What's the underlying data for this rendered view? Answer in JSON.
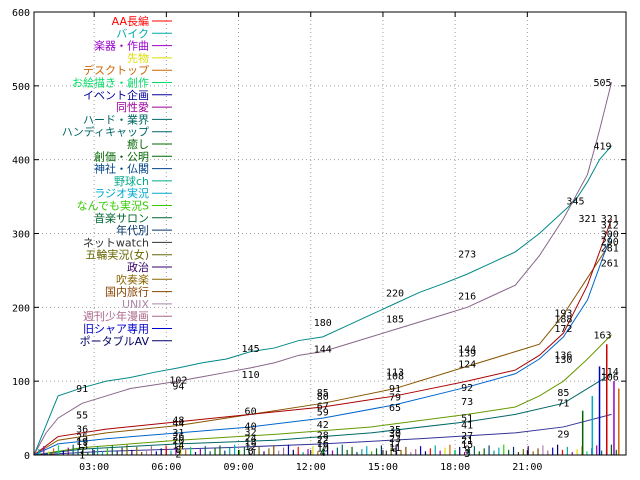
{
  "chart_data": {
    "type": "line",
    "x_ticks": [
      "03:00",
      "06:00",
      "09:00",
      "12:00",
      "15:00",
      "18:00",
      "21:00"
    ],
    "y_ticks": [
      "0",
      "100",
      "200",
      "300",
      "400",
      "500",
      "600"
    ],
    "ylim": [
      0,
      600
    ],
    "grid": true,
    "legend_position": "top-left",
    "series": [
      {
        "name": "AA長編",
        "color": "#ff0000"
      },
      {
        "name": "バイク",
        "color": "#00aaaa"
      },
      {
        "name": "楽器・作曲",
        "color": "#9900cc"
      },
      {
        "name": "先物",
        "color": "#dddd00"
      },
      {
        "name": "デスクトップ",
        "color": "#cc6600"
      },
      {
        "name": "お絵描き・創作",
        "color": "#00dd66"
      },
      {
        "name": "イベント企画",
        "color": "#000099"
      },
      {
        "name": "同性愛",
        "color": "#990099"
      },
      {
        "name": "ハード・業界",
        "color": "#006666"
      },
      {
        "name": "ハンディキャップ",
        "color": "#006666"
      },
      {
        "name": "癒し",
        "color": "#006600"
      },
      {
        "name": "創価・公明",
        "color": "#006600"
      },
      {
        "name": "神社・仏閣",
        "color": "#004488"
      },
      {
        "name": "野球ch",
        "color": "#00aa88"
      },
      {
        "name": "ラジオ実況",
        "color": "#00aacc"
      },
      {
        "name": "なんでも実況S",
        "color": "#33cc00"
      },
      {
        "name": "音楽サロン",
        "color": "#006633"
      },
      {
        "name": "年代別",
        "color": "#003366"
      },
      {
        "name": "ネットwatch",
        "color": "#333333"
      },
      {
        "name": "五輪実況(女)",
        "color": "#666600"
      },
      {
        "name": "政治",
        "color": "#330066"
      },
      {
        "name": "吹奏楽",
        "color": "#886600"
      },
      {
        "name": "国内旅行",
        "color": "#884400"
      },
      {
        "name": "UNIX",
        "color": "#aa88aa"
      },
      {
        "name": "週刊少年漫画",
        "color": "#aa6688"
      },
      {
        "name": "旧シャア専用",
        "color": "#0000cc"
      },
      {
        "name": "ポータブルAV",
        "color": "#000066"
      }
    ],
    "lines": [
      {
        "color": "#008888",
        "points": [
          [
            0,
            0
          ],
          [
            0.5,
            40
          ],
          [
            1,
            80
          ],
          [
            2,
            91
          ],
          [
            3,
            100
          ],
          [
            4,
            105
          ],
          [
            5,
            112
          ],
          [
            6,
            118
          ],
          [
            7,
            125
          ],
          [
            8,
            130
          ],
          [
            9,
            140
          ],
          [
            10,
            145
          ],
          [
            11,
            155
          ],
          [
            12,
            160
          ],
          [
            13,
            175
          ],
          [
            14,
            190
          ],
          [
            15,
            205
          ],
          [
            16,
            220
          ],
          [
            17,
            232
          ],
          [
            18,
            245
          ],
          [
            19,
            260
          ],
          [
            20,
            275
          ],
          [
            21,
            300
          ],
          [
            22,
            330
          ],
          [
            22.5,
            345
          ],
          [
            23,
            370
          ],
          [
            23.5,
            400
          ],
          [
            24,
            419
          ]
        ]
      },
      {
        "color": "#886688",
        "points": [
          [
            0,
            0
          ],
          [
            0.5,
            30
          ],
          [
            1,
            50
          ],
          [
            2,
            70
          ],
          [
            3,
            80
          ],
          [
            4,
            90
          ],
          [
            5,
            95
          ],
          [
            6,
            100
          ],
          [
            7,
            106
          ],
          [
            8,
            112
          ],
          [
            9,
            118
          ],
          [
            10,
            125
          ],
          [
            11,
            135
          ],
          [
            12,
            140
          ],
          [
            13,
            150
          ],
          [
            14,
            160
          ],
          [
            15,
            170
          ],
          [
            16,
            180
          ],
          [
            17,
            190
          ],
          [
            18,
            200
          ],
          [
            19,
            215
          ],
          [
            20,
            230
          ],
          [
            21,
            270
          ],
          [
            22,
            320
          ],
          [
            23,
            380
          ],
          [
            23.5,
            440
          ],
          [
            24,
            505
          ]
        ]
      },
      {
        "color": "#885500",
        "points": [
          [
            0,
            0
          ],
          [
            1,
            20
          ],
          [
            3,
            30
          ],
          [
            6,
            40
          ],
          [
            9,
            55
          ],
          [
            12,
            70
          ],
          [
            15,
            90
          ],
          [
            18,
            120
          ],
          [
            20,
            140
          ],
          [
            21,
            150
          ],
          [
            22,
            190
          ],
          [
            23,
            240
          ],
          [
            24,
            290
          ]
        ]
      },
      {
        "color": "#aa0000",
        "points": [
          [
            0,
            0
          ],
          [
            1,
            25
          ],
          [
            3,
            35
          ],
          [
            6,
            45
          ],
          [
            9,
            55
          ],
          [
            12,
            65
          ],
          [
            15,
            80
          ],
          [
            18,
            100
          ],
          [
            20,
            115
          ],
          [
            21,
            135
          ],
          [
            22,
            165
          ],
          [
            23,
            230
          ],
          [
            24,
            320
          ]
        ]
      },
      {
        "color": "#0066cc",
        "points": [
          [
            0,
            0
          ],
          [
            1,
            15
          ],
          [
            3,
            22
          ],
          [
            6,
            30
          ],
          [
            9,
            38
          ],
          [
            12,
            50
          ],
          [
            15,
            68
          ],
          [
            18,
            92
          ],
          [
            20,
            110
          ],
          [
            21,
            130
          ],
          [
            22,
            160
          ],
          [
            23,
            210
          ],
          [
            24,
            300
          ]
        ]
      },
      {
        "color": "#669900",
        "points": [
          [
            0,
            0
          ],
          [
            2,
            10
          ],
          [
            6,
            20
          ],
          [
            10,
            28
          ],
          [
            14,
            38
          ],
          [
            18,
            55
          ],
          [
            20,
            65
          ],
          [
            21,
            80
          ],
          [
            22,
            100
          ],
          [
            23,
            130
          ],
          [
            24,
            163
          ]
        ]
      },
      {
        "color": "#006666",
        "points": [
          [
            0,
            0
          ],
          [
            2,
            8
          ],
          [
            6,
            15
          ],
          [
            10,
            20
          ],
          [
            14,
            30
          ],
          [
            18,
            45
          ],
          [
            20,
            55
          ],
          [
            22,
            70
          ],
          [
            23,
            90
          ],
          [
            24,
            110
          ]
        ]
      },
      {
        "color": "#333399",
        "points": [
          [
            0,
            0
          ],
          [
            3,
            5
          ],
          [
            8,
            10
          ],
          [
            12,
            15
          ],
          [
            16,
            22
          ],
          [
            20,
            30
          ],
          [
            22,
            38
          ],
          [
            24,
            55
          ]
        ]
      }
    ],
    "data_labels": [
      {
        "text": "505",
        "x": 24,
        "y": 505
      },
      {
        "text": "419",
        "x": 24,
        "y": 419
      },
      {
        "text": "345",
        "x": 22.5,
        "y": 345
      },
      {
        "text": "321",
        "x": 23,
        "y": 321
      },
      {
        "text": "321",
        "x": 24.3,
        "y": 321
      },
      {
        "text": "312",
        "x": 24.3,
        "y": 312
      },
      {
        "text": "300",
        "x": 24.3,
        "y": 300
      },
      {
        "text": "290",
        "x": 24.3,
        "y": 290
      },
      {
        "text": "281",
        "x": 24.3,
        "y": 281
      },
      {
        "text": "273",
        "x": 18,
        "y": 273
      },
      {
        "text": "261",
        "x": 24.3,
        "y": 261
      },
      {
        "text": "220",
        "x": 15,
        "y": 220
      },
      {
        "text": "216",
        "x": 18,
        "y": 216
      },
      {
        "text": "193",
        "x": 22,
        "y": 193
      },
      {
        "text": "188",
        "x": 22,
        "y": 185
      },
      {
        "text": "185",
        "x": 15,
        "y": 185
      },
      {
        "text": "180",
        "x": 12,
        "y": 180
      },
      {
        "text": "172",
        "x": 22,
        "y": 172
      },
      {
        "text": "163",
        "x": 24,
        "y": 163
      },
      {
        "text": "145",
        "x": 9,
        "y": 145
      },
      {
        "text": "144",
        "x": 12,
        "y": 144
      },
      {
        "text": "144",
        "x": 18,
        "y": 144
      },
      {
        "text": "139",
        "x": 18,
        "y": 139
      },
      {
        "text": "136",
        "x": 22,
        "y": 136
      },
      {
        "text": "130",
        "x": 22,
        "y": 130
      },
      {
        "text": "124",
        "x": 18,
        "y": 124
      },
      {
        "text": "114",
        "x": 24.3,
        "y": 114
      },
      {
        "text": "113",
        "x": 15,
        "y": 113
      },
      {
        "text": "110",
        "x": 9,
        "y": 110
      },
      {
        "text": "108",
        "x": 15,
        "y": 108
      },
      {
        "text": "106",
        "x": 24.3,
        "y": 106
      },
      {
        "text": "102",
        "x": 6,
        "y": 102
      },
      {
        "text": "94",
        "x": 6,
        "y": 94
      },
      {
        "text": "91",
        "x": 2,
        "y": 91
      },
      {
        "text": "92",
        "x": 18,
        "y": 92
      },
      {
        "text": "91",
        "x": 15,
        "y": 91
      },
      {
        "text": "85",
        "x": 12,
        "y": 85
      },
      {
        "text": "85",
        "x": 22,
        "y": 85
      },
      {
        "text": "80",
        "x": 12,
        "y": 80
      },
      {
        "text": "79",
        "x": 15,
        "y": 79
      },
      {
        "text": "73",
        "x": 18,
        "y": 73
      },
      {
        "text": "71",
        "x": 22,
        "y": 71
      },
      {
        "text": "67",
        "x": 12,
        "y": 67
      },
      {
        "text": "65",
        "x": 15,
        "y": 65
      },
      {
        "text": "60",
        "x": 9,
        "y": 60
      },
      {
        "text": "59",
        "x": 12,
        "y": 59
      },
      {
        "text": "55",
        "x": 2,
        "y": 55
      },
      {
        "text": "51",
        "x": 18,
        "y": 51
      },
      {
        "text": "48",
        "x": 6,
        "y": 48
      },
      {
        "text": "44",
        "x": 6,
        "y": 44
      },
      {
        "text": "42",
        "x": 12,
        "y": 42
      },
      {
        "text": "41",
        "x": 18,
        "y": 41
      },
      {
        "text": "40",
        "x": 9,
        "y": 40
      },
      {
        "text": "36",
        "x": 2,
        "y": 36
      },
      {
        "text": "35",
        "x": 15,
        "y": 35
      },
      {
        "text": "32",
        "x": 9,
        "y": 32
      },
      {
        "text": "31",
        "x": 6,
        "y": 31
      },
      {
        "text": "30",
        "x": 15,
        "y": 30
      },
      {
        "text": "29",
        "x": 22,
        "y": 29
      },
      {
        "text": "28",
        "x": 12,
        "y": 28
      },
      {
        "text": "27",
        "x": 18,
        "y": 27
      },
      {
        "text": "26",
        "x": 6,
        "y": 26
      },
      {
        "text": "25",
        "x": 2,
        "y": 25
      },
      {
        "text": "24",
        "x": 9,
        "y": 24
      },
      {
        "text": "23",
        "x": 15,
        "y": 23
      },
      {
        "text": "22",
        "x": 12,
        "y": 22
      },
      {
        "text": "21",
        "x": 18,
        "y": 21
      },
      {
        "text": "20",
        "x": 6,
        "y": 20
      },
      {
        "text": "19",
        "x": 2,
        "y": 19
      },
      {
        "text": "18",
        "x": 9,
        "y": 18
      },
      {
        "text": "17",
        "x": 15,
        "y": 17
      },
      {
        "text": "16",
        "x": 12,
        "y": 16
      },
      {
        "text": "15",
        "x": 18,
        "y": 15
      },
      {
        "text": "14",
        "x": 6,
        "y": 14
      },
      {
        "text": "13",
        "x": 2,
        "y": 13
      },
      {
        "text": "12",
        "x": 9,
        "y": 12
      },
      {
        "text": "11",
        "x": 15,
        "y": 11
      },
      {
        "text": "10",
        "x": 12,
        "y": 10
      },
      {
        "text": "9",
        "x": 18,
        "y": 9
      },
      {
        "text": "8",
        "x": 6,
        "y": 8
      },
      {
        "text": "7",
        "x": 2,
        "y": 7
      },
      {
        "text": "6",
        "x": 9,
        "y": 6
      },
      {
        "text": "5",
        "x": 15,
        "y": 5
      },
      {
        "text": "4",
        "x": 12,
        "y": 4
      },
      {
        "text": "3",
        "x": 18,
        "y": 3
      },
      {
        "text": "2",
        "x": 6,
        "y": 2
      },
      {
        "text": "1",
        "x": 2,
        "y": 1
      }
    ]
  }
}
